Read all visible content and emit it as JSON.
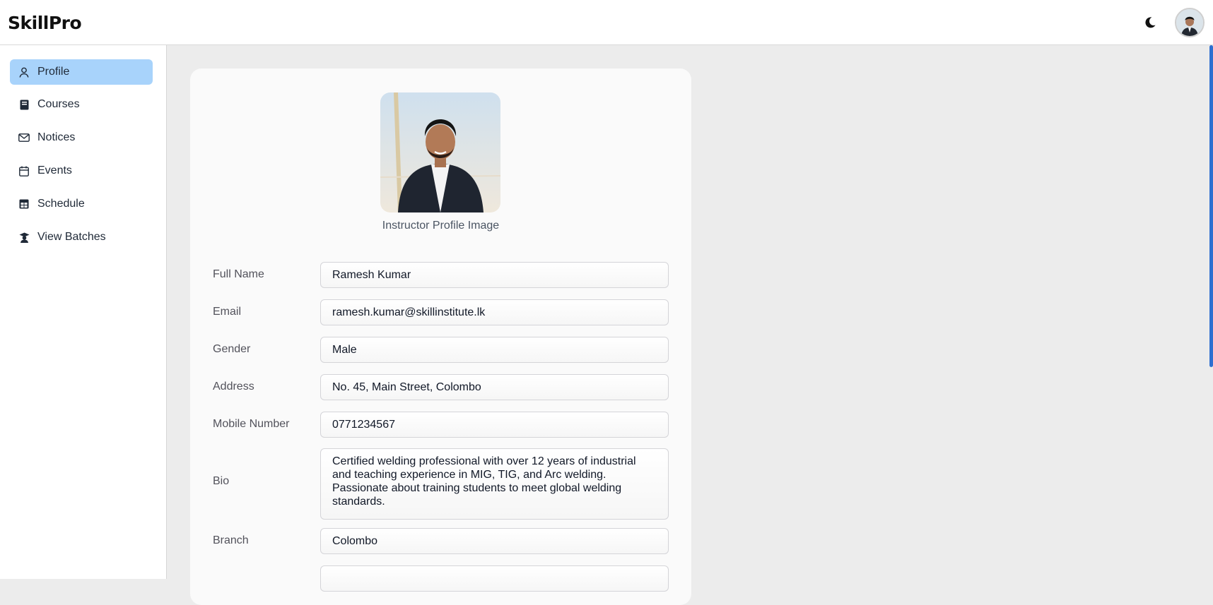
{
  "app": {
    "brand": "SkillPro"
  },
  "header": {
    "theme_icon": "moon-icon",
    "avatar_icon": "user-avatar"
  },
  "sidebar": {
    "items": [
      {
        "label": "Profile",
        "icon": "user-icon",
        "active": true
      },
      {
        "label": "Courses",
        "icon": "book-icon",
        "active": false
      },
      {
        "label": "Notices",
        "icon": "mail-icon",
        "active": false
      },
      {
        "label": "Events",
        "icon": "calendar-icon",
        "active": false
      },
      {
        "label": "Schedule",
        "icon": "grid-icon",
        "active": false
      },
      {
        "label": "View Batches",
        "icon": "graduation-icon",
        "active": false
      }
    ]
  },
  "profile": {
    "image_caption": "Instructor Profile Image",
    "fields": [
      {
        "label": "Full Name",
        "value": "Ramesh Kumar"
      },
      {
        "label": "Email",
        "value": "ramesh.kumar@skillinstitute.lk"
      },
      {
        "label": "Gender",
        "value": "Male"
      },
      {
        "label": "Address",
        "value": "No. 45, Main Street, Colombo"
      },
      {
        "label": "Mobile Number",
        "value": "0771234567"
      },
      {
        "label": "Bio",
        "value": "Certified welding professional with over 12 years of industrial and teaching experience in MIG, TIG, and Arc welding. Passionate about training students to meet global welding standards."
      },
      {
        "label": "Branch",
        "value": "Colombo"
      },
      {
        "label": "",
        "value": ""
      }
    ]
  },
  "colors": {
    "active_nav": "#a8d3fb",
    "scrollbar": "#2f6fd0",
    "page_bg": "#ececec"
  }
}
